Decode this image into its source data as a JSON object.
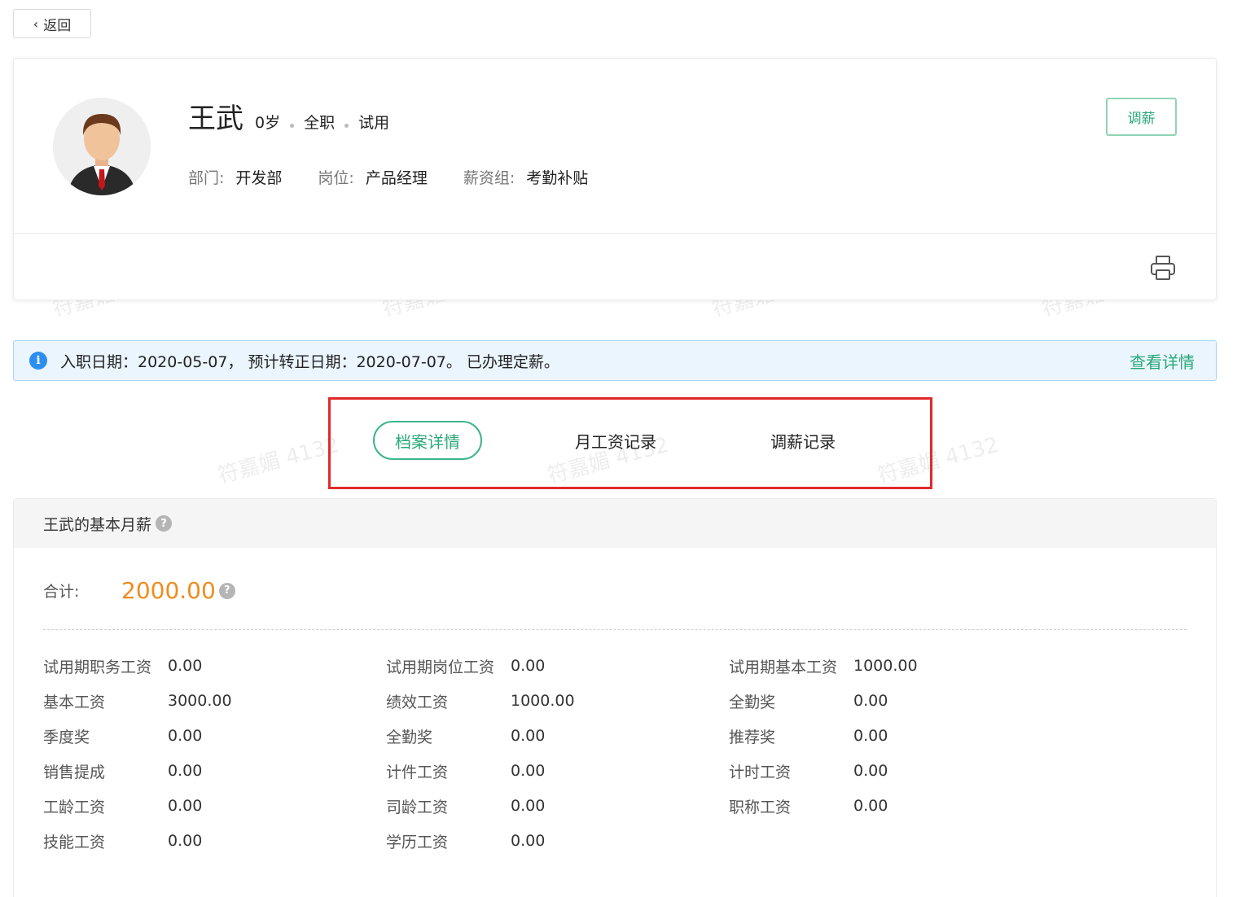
{
  "back": {
    "label": "返回"
  },
  "profile": {
    "name": "王武",
    "age": "0岁",
    "work_type": "全职",
    "status": "试用",
    "department_label": "部门:",
    "department": "开发部",
    "position_label": "岗位:",
    "position": "产品经理",
    "salary_group_label": "薪资组:",
    "salary_group": "考勤补贴",
    "adjust_button": "调薪"
  },
  "alert": {
    "text": "入职日期：2020-05-07， 预计转正日期：2020-07-07。 已办理定薪。",
    "link": "查看详情"
  },
  "tabs": [
    {
      "label": "档案详情",
      "active": true
    },
    {
      "label": "月工资记录",
      "active": false
    },
    {
      "label": "调薪记录",
      "active": false
    }
  ],
  "salary": {
    "title": "王武的基本月薪",
    "total_label": "合计:",
    "total_value": "2000.00",
    "items": [
      {
        "label": "试用期职务工资",
        "value": "0.00"
      },
      {
        "label": "试用期岗位工资",
        "value": "0.00"
      },
      {
        "label": "试用期基本工资",
        "value": "1000.00"
      },
      {
        "label": "基本工资",
        "value": "3000.00"
      },
      {
        "label": "绩效工资",
        "value": "1000.00"
      },
      {
        "label": "全勤奖",
        "value": "0.00"
      },
      {
        "label": "季度奖",
        "value": "0.00"
      },
      {
        "label": "全勤奖",
        "value": "0.00"
      },
      {
        "label": "推荐奖",
        "value": "0.00"
      },
      {
        "label": "销售提成",
        "value": "0.00"
      },
      {
        "label": "计件工资",
        "value": "0.00"
      },
      {
        "label": "计时工资",
        "value": "0.00"
      },
      {
        "label": "工龄工资",
        "value": "0.00"
      },
      {
        "label": "司龄工资",
        "value": "0.00"
      },
      {
        "label": "职称工资",
        "value": "0.00"
      },
      {
        "label": "技能工资",
        "value": "0.00"
      },
      {
        "label": "学历工资",
        "value": "0.00"
      }
    ]
  },
  "watermark": "符嘉媚 4132",
  "colors": {
    "accent_green": "#2aa878",
    "total_orange": "#f08c1e",
    "info_blue": "#2d8ef1",
    "highlight_red": "#e02a2a"
  }
}
